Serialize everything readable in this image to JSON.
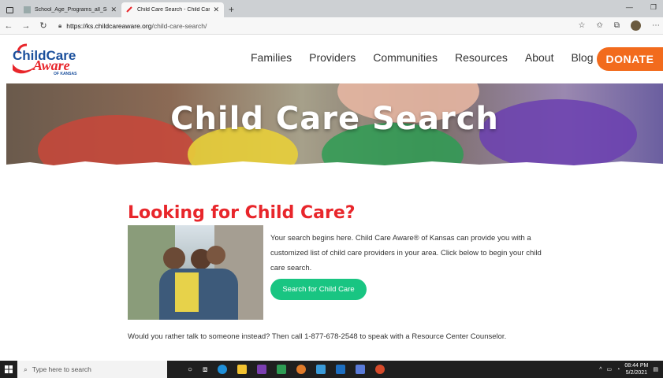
{
  "browser": {
    "tabs": [
      {
        "title": "School_Age_Programs_all_Sectio",
        "active": false
      },
      {
        "title": "Child Care Search - Child Care A",
        "active": true
      }
    ],
    "url_host": "https://ks.childcareaware.org",
    "url_path": "/child-care-search/"
  },
  "site": {
    "logo_top": "ChildCare",
    "logo_mid": "Aware",
    "logo_sub": "OF KANSAS",
    "nav": [
      "Families",
      "Providers",
      "Communities",
      "Resources",
      "About",
      "Blog"
    ],
    "donate_label": "DONATE"
  },
  "hero": {
    "title": "Child Care Search"
  },
  "main": {
    "heading": "Looking for Child Care?",
    "description": "Your search begins here. Child Care Aware® of Kansas can provide you with a customized list of child care providers in your area. Click below to begin your child care search.",
    "cta_label": "Search for Child Care",
    "call_text": "Would you rather talk to someone instead? Then call 1-877-678-2548 to speak with a Resource Center Counselor."
  },
  "taskbar": {
    "search_placeholder": "Type here to search",
    "time": "08:44 PM",
    "date": "5/2/2021"
  },
  "colors": {
    "accent_red": "#e8262b",
    "donate_orange": "#f26b1d",
    "cta_green": "#19c582",
    "logo_blue": "#1a4f9c"
  }
}
